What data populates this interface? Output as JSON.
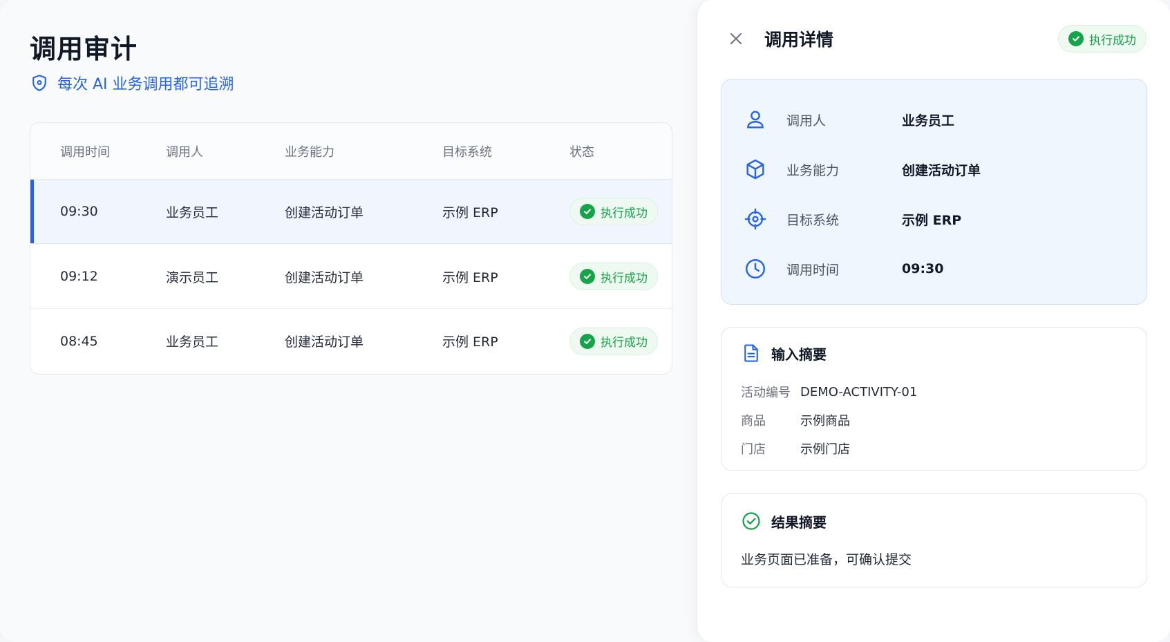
{
  "audit": {
    "title": "调用审计",
    "subtitle": "每次 AI 业务调用都可追溯",
    "columns": [
      "调用时间",
      "调用人",
      "业务能力",
      "目标系统",
      "状态"
    ],
    "rows": [
      {
        "time": "09:30",
        "caller": "业务员工",
        "capability": "创建活动订单",
        "system": "示例 ERP",
        "status": "执行成功"
      },
      {
        "time": "09:12",
        "caller": "演示员工",
        "capability": "创建活动订单",
        "system": "示例 ERP",
        "status": "执行成功"
      },
      {
        "time": "08:45",
        "caller": "业务员工",
        "capability": "创建活动订单",
        "system": "示例 ERP",
        "status": "执行成功"
      }
    ]
  },
  "detail": {
    "title": "调用详情",
    "status": "执行成功",
    "info": [
      {
        "label": "调用人",
        "value": "业务员工",
        "icon": "user-icon"
      },
      {
        "label": "业务能力",
        "value": "创建活动订单",
        "icon": "cube-icon"
      },
      {
        "label": "目标系统",
        "value": "示例 ERP",
        "icon": "target-icon"
      },
      {
        "label": "调用时间",
        "value": "09:30",
        "icon": "clock-icon"
      }
    ],
    "input": {
      "title": "输入摘要",
      "fields": [
        {
          "key": "活动编号",
          "value": "DEMO-ACTIVITY-01"
        },
        {
          "key": "商品",
          "value": "示例商品"
        },
        {
          "key": "门店",
          "value": "示例门店"
        }
      ]
    },
    "result": {
      "title": "结果摘要",
      "text": "业务页面已准备，可确认提交"
    }
  },
  "colors": {
    "accent": "#2563eb",
    "success": "#16a34a",
    "success_bg": "#eefaf1",
    "info_card_bg": "#f0f6fe"
  }
}
